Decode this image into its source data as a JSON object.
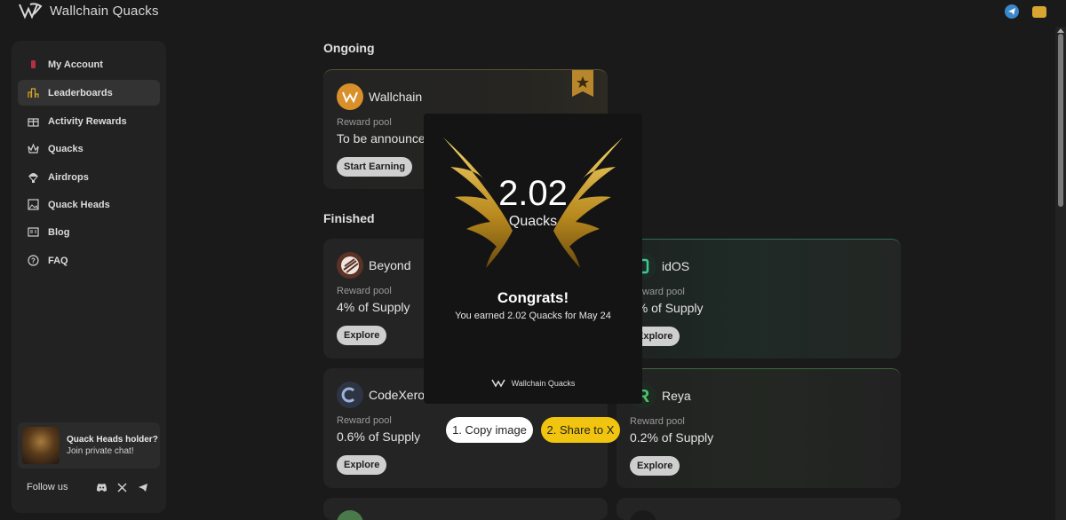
{
  "app": {
    "title": "Wallchain Quacks"
  },
  "sidebar": {
    "items": [
      {
        "label": "My Account",
        "icon": "account-icon"
      },
      {
        "label": "Leaderboards",
        "icon": "leaderboard-icon",
        "active": true
      },
      {
        "label": "Activity Rewards",
        "icon": "gift-icon"
      },
      {
        "label": "Quacks",
        "icon": "crown-icon"
      },
      {
        "label": "Airdrops",
        "icon": "parachute-icon"
      },
      {
        "label": "Quack Heads",
        "icon": "image-icon"
      },
      {
        "label": "Blog",
        "icon": "blog-icon"
      },
      {
        "label": "FAQ",
        "icon": "question-icon"
      }
    ],
    "promo": {
      "title": "Quack Heads holder?",
      "subtitle": "Join private chat!"
    },
    "follow_label": "Follow us",
    "socials": [
      "discord-icon",
      "x-icon",
      "telegram-icon"
    ]
  },
  "main": {
    "ongoing_title": "Ongoing",
    "finished_title": "Finished",
    "cards": [
      {
        "name": "Wallchain",
        "pool_label": "Reward pool",
        "pool_value": "To be announced",
        "button": "Start Earning"
      },
      {
        "name": "Beyond",
        "pool_label": "Reward pool",
        "pool_value": "4% of Supply",
        "button": "Explore"
      },
      {
        "name": "idOS",
        "pool_label": "Reward pool",
        "pool_value": "2% of Supply",
        "button": "Explore"
      },
      {
        "name": "CodeXero",
        "pool_label": "Reward pool",
        "pool_value": "0.6% of Supply",
        "button": "Explore"
      },
      {
        "name": "Reya",
        "pool_label": "Reward pool",
        "pool_value": "0.2% of Supply",
        "button": "Explore"
      }
    ]
  },
  "modal": {
    "amount": "2.02",
    "unit": "Quacks",
    "title": "Congrats!",
    "message": "You earned 2.02 Quacks for May 24",
    "brand": "Wallchain Quacks",
    "copy_button": "1. Copy image",
    "share_button": "2. Share to X"
  },
  "colors": {
    "accent": "#f1c40f",
    "gold": "#c9a227",
    "background": "#1a1a1a"
  }
}
